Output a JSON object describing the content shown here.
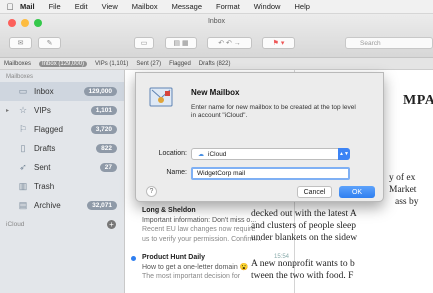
{
  "menubar": {
    "app": "Mail",
    "items": [
      "File",
      "Edit",
      "View",
      "Mailbox",
      "Message",
      "Format",
      "Window",
      "Help"
    ]
  },
  "window": {
    "title": "Inbox",
    "search_placeholder": "Search"
  },
  "favorites": {
    "mailboxes": "Mailboxes",
    "inbox": "Inbox (129,000)",
    "vips": "VIPs (1,101)",
    "sent": "Sent (27)",
    "flagged": "Flagged",
    "drafts": "Drafts (822)"
  },
  "sidebar": {
    "heading": "Mailboxes",
    "items": [
      {
        "label": "Inbox",
        "badge": "129,000",
        "icon": "inbox-icon"
      },
      {
        "label": "VIPs",
        "badge": "1,101",
        "icon": "star-icon"
      },
      {
        "label": "Flagged",
        "badge": "3,720",
        "icon": "flag-icon"
      },
      {
        "label": "Drafts",
        "badge": "822",
        "icon": "document-icon"
      },
      {
        "label": "Sent",
        "badge": "27",
        "icon": "paper-plane-icon"
      },
      {
        "label": "Trash",
        "badge": "",
        "icon": "trash-icon"
      },
      {
        "label": "Archive",
        "badge": "32,071",
        "icon": "archive-icon"
      }
    ],
    "account": "iCloud"
  },
  "messages": [
    {
      "sender": "Long & Sheldon",
      "time": "",
      "line1": "Important information: Don't miss o...",
      "line2": "Recent EU law changes now require",
      "line3": "us to verify your permission. Confirm..."
    },
    {
      "sender": "Product Hunt Daily",
      "time": "15:54",
      "line1": "How to get a one-letter domain 😮",
      "line2": "The most important decision for",
      "line3": ""
    }
  ],
  "article": {
    "header": "MPA",
    "lines": [
      "y of ex",
      "Market",
      "ass by",
      "decked out with the latest A",
      "and clusters of people sleep",
      "under blankets on the sidew",
      "A new nonprofit wants to b",
      "tween the two with food. F"
    ]
  },
  "dialog": {
    "title": "New Mailbox",
    "description": "Enter name for new mailbox to be created at the top level in account \"iCloud\".",
    "location_label": "Location:",
    "location_value": "iCloud",
    "name_label": "Name:",
    "name_value": "WidgetCorp mail",
    "help": "?",
    "cancel": "Cancel",
    "ok": "OK"
  },
  "colors": {
    "accent": "#2f7ff0",
    "badge": "#8f9aa8"
  }
}
